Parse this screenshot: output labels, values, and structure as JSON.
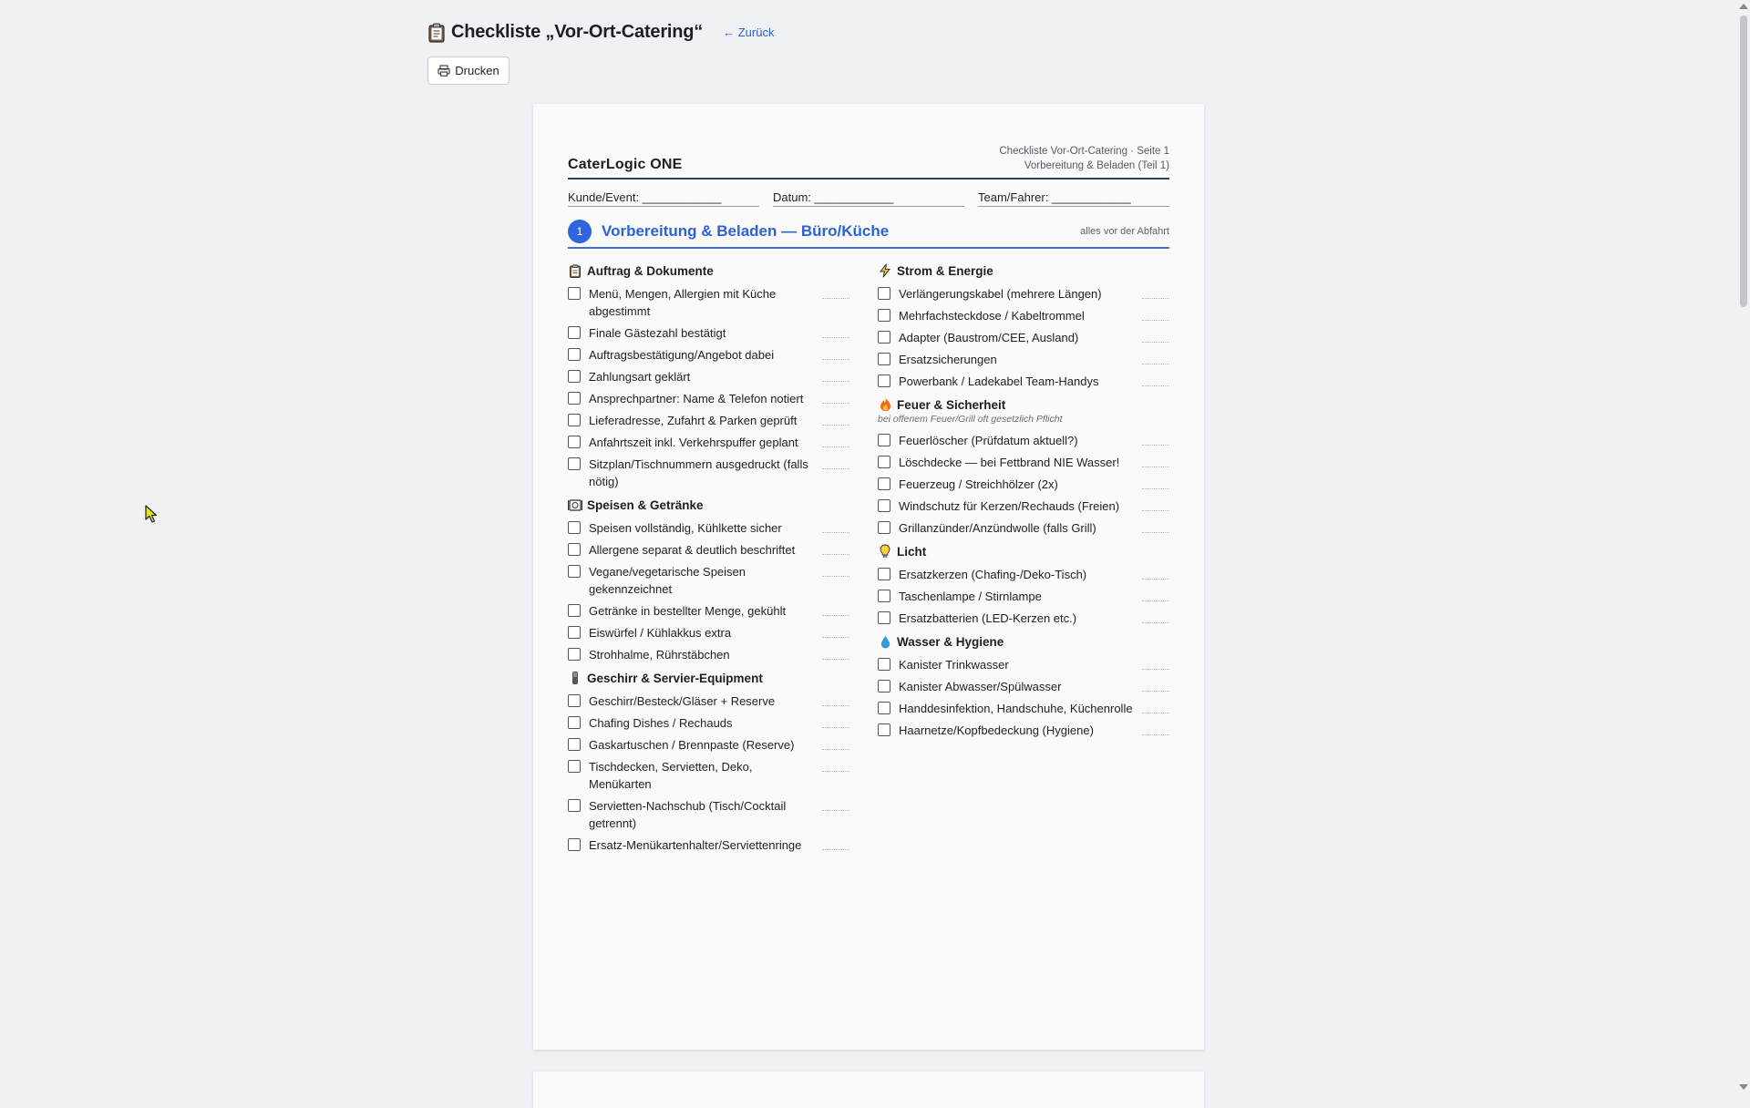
{
  "header": {
    "title": "Checkliste „Vor-Ort-Catering“",
    "back_link": "← Zurück",
    "print_button": "Drucken"
  },
  "sheet": {
    "brand": "CaterLogic ONE",
    "page_info_line1": "Checkliste Vor-Ort-Catering · Seite 1",
    "page_info_line2": "Vorbereitung & Beladen (Teil 1)",
    "fields": [
      "Kunde/Event: ____________",
      "Datum: ____________",
      "Team/Fahrer: ____________"
    ],
    "section": {
      "number": "1",
      "title": "Vorbereitung & Beladen — Büro/Küche",
      "note": "alles vor der Abfahrt"
    },
    "left_groups": [
      {
        "title": "Auftrag & Dokumente",
        "icon": "clipboard-icon",
        "items": [
          "Menü, Mengen, Allergien mit Küche abgestimmt",
          "Finale Gästezahl bestätigt",
          "Auftragsbestätigung/Angebot dabei",
          "Zahlungsart geklärt",
          "Ansprechpartner: Name & Telefon notiert",
          "Lieferadresse, Zufahrt & Parken geprüft",
          "Anfahrtszeit inkl. Verkehrspuffer geplant",
          "Sitzplan/Tischnummern ausgedruckt (falls nötig)"
        ]
      },
      {
        "title": "Speisen & Getränke",
        "icon": "dish-icon",
        "items": [
          "Speisen vollständig, Kühlkette sicher",
          "Allergene separat & deutlich beschriftet",
          "Vegane/vegetarische Speisen gekennzeichnet",
          "Getränke in bestellter Menge, gekühlt",
          "Eiswürfel / Kühlakkus extra",
          "Strohhalme, Rührstäbchen"
        ]
      },
      {
        "title": "Geschirr & Servier-Equipment",
        "icon": "cutlery-icon",
        "items": [
          "Geschirr/Besteck/Gläser + Reserve",
          "Chafing Dishes / Rechauds",
          "Gaskartuschen / Brennpaste (Reserve)",
          "Tischdecken, Servietten, Deko, Menükarten",
          "Servietten-Nachschub (Tisch/Cocktail getrennt)",
          "Ersatz-Menükartenhalter/Serviettenringe"
        ]
      }
    ],
    "right_groups": [
      {
        "title": "Strom & Energie",
        "icon": "lightning-icon",
        "items": [
          "Verlängerungskabel (mehrere Längen)",
          "Mehrfachsteckdose / Kabeltrommel",
          "Adapter (Baustrom/CEE, Ausland)",
          "Ersatzsicherungen",
          "Powerbank / Ladekabel Team-Handys"
        ]
      },
      {
        "title": "Feuer & Sicherheit",
        "icon": "fire-icon",
        "note": "bei offenem Feuer/Grill oft gesetzlich Pflicht",
        "items": [
          "Feuerlöscher (Prüfdatum aktuell?)",
          "Löschdecke — bei Fettbrand NIE Wasser!",
          "Feuerzeug / Streichhölzer (2x)",
          "Windschutz für Kerzen/Rechauds (Freien)",
          "Grillanzünder/Anzündwolle (falls Grill)"
        ]
      },
      {
        "title": "Licht",
        "icon": "bulb-icon",
        "items": [
          "Ersatzkerzen (Chafing-/Deko-Tisch)",
          "Taschenlampe / Stirnlampe",
          "Ersatzbatterien (LED-Kerzen etc.)"
        ]
      },
      {
        "title": "Wasser & Hygiene",
        "icon": "droplet-icon",
        "items": [
          "Kanister Trinkwasser",
          "Kanister Abwasser/Spülwasser",
          "Handdesinfektion, Handschuhe, Küchenrolle",
          "Haarnetze/Kopfbedeckung (Hygiene)"
        ]
      }
    ]
  }
}
